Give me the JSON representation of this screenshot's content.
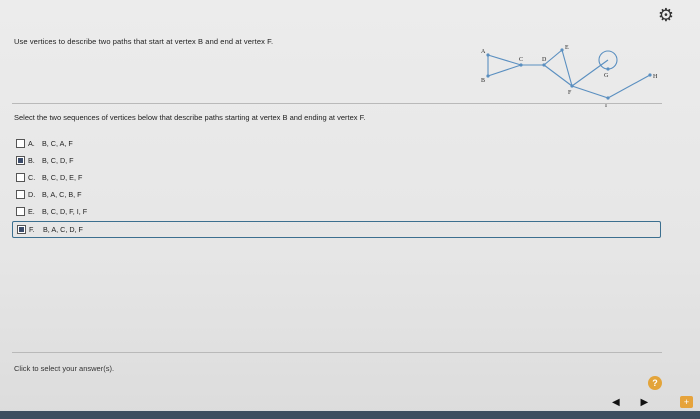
{
  "header": {
    "settings_icon": "gear-icon"
  },
  "question": {
    "text": "Use vertices to describe two paths that start at vertex B and end at vertex F."
  },
  "graph": {
    "labels": {
      "A": "A",
      "B": "B",
      "C": "C",
      "D": "D",
      "E": "E",
      "F": "F",
      "G": "G",
      "H": "H",
      "I": "I"
    }
  },
  "instruction": {
    "text": "Select the two sequences of vertices below that describe paths starting at vertex B and ending at vertex F."
  },
  "options": [
    {
      "letter": "A.",
      "text": "B, C, A, F",
      "checked": false
    },
    {
      "letter": "B.",
      "text": "B, C, D, F",
      "checked": true
    },
    {
      "letter": "C.",
      "text": "B, C, D, E, F",
      "checked": false
    },
    {
      "letter": "D.",
      "text": "B, A, C, B, F",
      "checked": false
    },
    {
      "letter": "E.",
      "text": "B, C, D, F, I, F",
      "checked": false
    },
    {
      "letter": "F.",
      "text": "B, A, C, D, F",
      "checked": true
    }
  ],
  "footer": {
    "hint": "Click to select your answer(s).",
    "help": "?"
  },
  "nav": {
    "prev": "◀",
    "next": "▶",
    "corner": "+"
  }
}
